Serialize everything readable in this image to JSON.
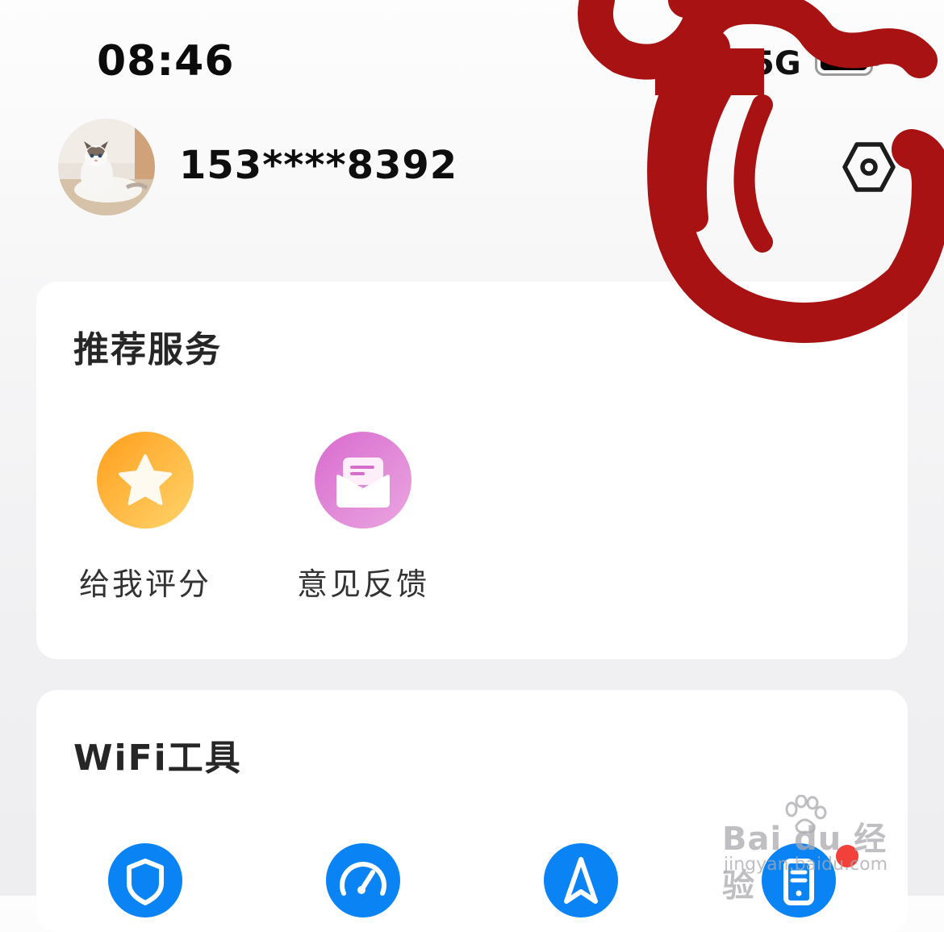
{
  "status_bar": {
    "time": "08:46",
    "signal_text": "5G",
    "battery_icon": "battery-full-icon"
  },
  "profile": {
    "phone": "153****8392",
    "avatar_icon": "cat-avatar",
    "settings_icon": "hexagon-settings-icon"
  },
  "recommend": {
    "title": "推荐服务",
    "items": [
      {
        "label": "给我评分",
        "icon": "star-icon",
        "color": "#ffb133"
      },
      {
        "label": "意见反馈",
        "icon": "mail-feedback-icon",
        "color": "#df7fd6"
      }
    ]
  },
  "wifi_tools": {
    "title": "WiFi工具",
    "items": [
      {
        "icon": "shield-icon"
      },
      {
        "icon": "speedometer-icon"
      },
      {
        "icon": "navigation-arrow-icon"
      },
      {
        "icon": "router-icon",
        "badge": true
      }
    ],
    "accent": "#0a84f5"
  },
  "watermark": {
    "main": "Bai du 经验",
    "sub": "jingyan.baidu.com"
  },
  "colors": {
    "scribble": "#a81212",
    "badge": "#f2403a"
  }
}
